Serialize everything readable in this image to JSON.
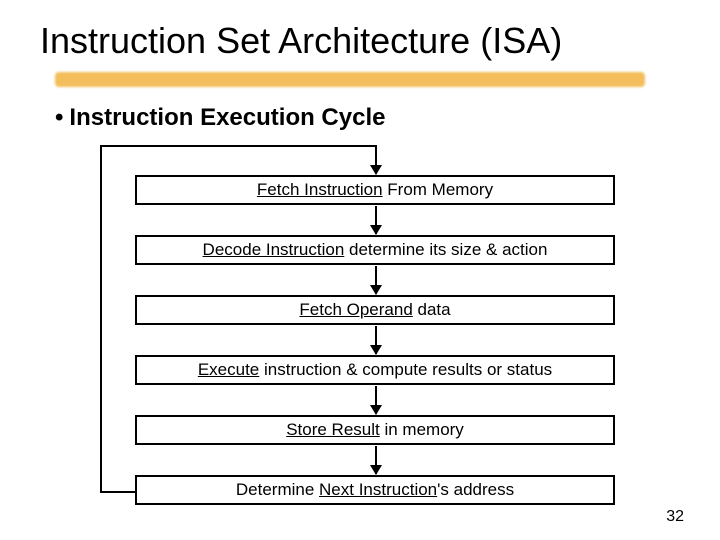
{
  "title": "Instruction Set Architecture (ISA)",
  "subtitle": "Instruction Execution Cycle",
  "bullet": "•",
  "steps": {
    "s1a": "Fetch Instruction",
    "s1b": " From Memory",
    "s2a": "Decode Instruction",
    "s2b": " determine its size & action",
    "s3a": "Fetch Operand",
    "s3b": " data",
    "s4a": "Execute",
    "s4b": " instruction & compute results or status",
    "s5a": "Store Result",
    "s5b": " in memory",
    "s6a": "Determine ",
    "s6b": "Next Instruction",
    "s6c": "'s address"
  },
  "page": "32"
}
